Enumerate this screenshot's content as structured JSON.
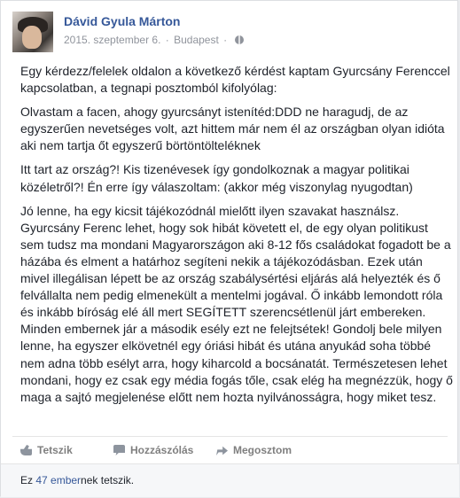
{
  "post": {
    "author": "Dávid Gyula Márton",
    "date": "2015. szeptember 6.",
    "location": "Budapest",
    "separator": "·",
    "paragraphs": [
      "Egy kérdezz/felelek oldalon a következő kérdést kaptam Gyurcsány Ferenccel kapcsolatban, a tegnapi posztomból kifolyólag:",
      "Olvastam a facen, ahogy gyurcsányt istenítéd:DDD ne haragudj, de az egyszerűen nevetséges volt, azt hittem már nem él az országban olyan idióta aki nem tartja őt egyszerű börtöntölteléknek",
      "Itt tart az ország?! Kis tizenévesek így gondolkoznak a magyar politikai közéletről?! Én erre így válaszoltam: (akkor még viszonylag nyugodtan)",
      "Jó lenne, ha egy kicsit tájékozódnál mielőtt ilyen szavakat használsz. Gyurcsány Ferenc lehet, hogy sok hibát követett el, de egy olyan politikust sem tudsz ma mondani Magyarországon aki 8-12 fős családokat fogadott be a házába és elment a határhoz segíteni nekik a tájékozódásban. Ezek után mivel illegálisan lépett be az ország szabálysértési eljárás alá helyezték és ő felvállalta nem pedig elmenekült a mentelmi jogával. Ő inkább lemondott róla és inkább bíróság elé áll mert SEGÍTETT szerencsétlenül járt embereken. Minden embernek jár a második esély ezt ne felejtsétek! Gondolj bele milyen lenne, ha egyszer elkövetnél egy óriási hibát és utána anyukád soha többé nem adna több esélyt arra, hogy kiharcold a bocsánatát. Természetesen lehet mondani, hogy ez csak egy média fogás tőle, csak elég ha megnézzük, hogy ő maga a sajtó megjelenése előtt nem hozta nyilvánosságra, hogy miket tesz."
    ]
  },
  "actions": {
    "like": "Tetszik",
    "comment": "Hozzászólás",
    "share": "Megosztom"
  },
  "likes": {
    "prefix": "Ez ",
    "link": "47 ember",
    "suffix": "nek tetszik."
  },
  "colors": {
    "link_blue": "#365899",
    "meta_gray": "#90949c",
    "text": "#1d2129",
    "background": "#e9ebee"
  },
  "icons": [
    "globe-icon",
    "like-icon",
    "comment-icon",
    "share-icon"
  ]
}
